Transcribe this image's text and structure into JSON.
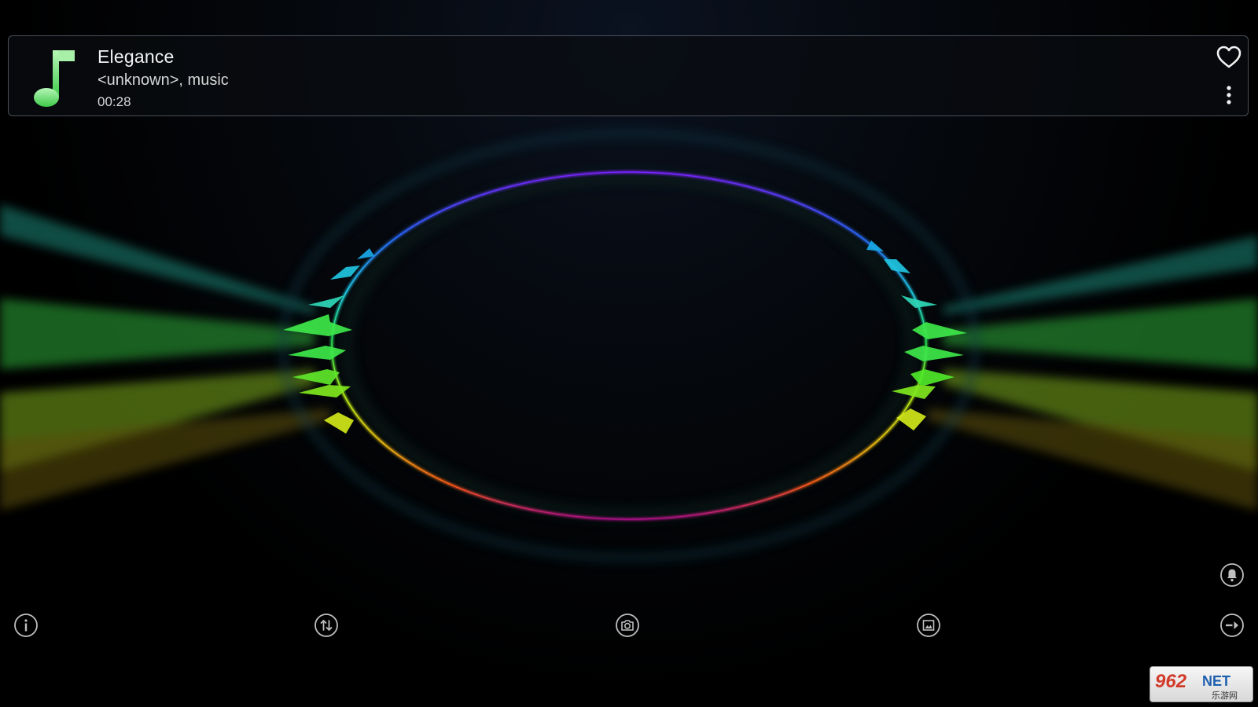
{
  "track": {
    "title": "Elegance",
    "artist_album": "<unknown>, music",
    "elapsed": "00:28"
  },
  "icons": {
    "music": "music-note-icon",
    "favorite": "heart-outline-icon",
    "more": "more-vertical-icon",
    "notification": "bell-icon",
    "info": "info-icon",
    "switch": "swap-vertical-icon",
    "snapshot": "camera-icon",
    "image": "image-frame-icon",
    "exit": "exit-visualizer-icon"
  },
  "colors": {
    "accent_note": "#5fdc6a",
    "icon_stroke": "#cfcfcf",
    "card_border": "#4a4f57"
  },
  "watermark": {
    "text": "962NET",
    "subtext": "乐游网"
  }
}
